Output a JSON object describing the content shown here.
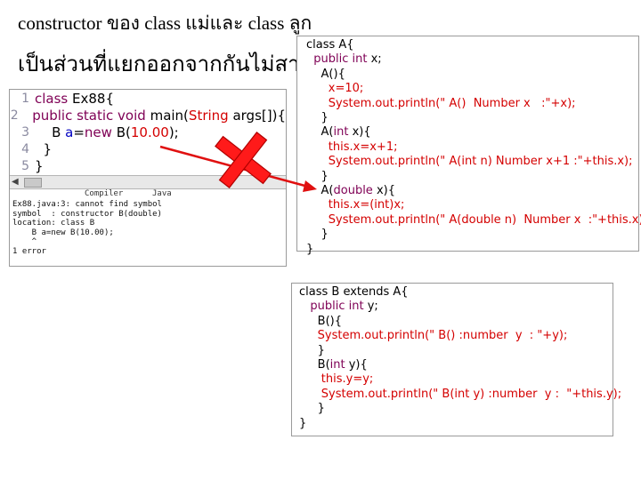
{
  "header": {
    "line1": "constructor ของ class แม่และ   class ลูก",
    "line2": "เป็นส่วนที่แยกออกจากกันไม่สามารถ"
  },
  "classA": {
    "lines": [
      [
        [
          "class A{",
          "blk"
        ]
      ],
      [
        [
          "  public int ",
          "k"
        ],
        [
          "x;",
          "blk"
        ]
      ],
      [
        [
          "    A(){",
          "blk"
        ]
      ],
      [
        [
          "      x=10;",
          "red"
        ]
      ],
      [
        [
          "      System.out.println(\" A()  Number x   :\"+x);",
          "red"
        ]
      ],
      [
        [
          "    }",
          "blk"
        ]
      ],
      [
        [
          "    A(",
          "blk"
        ],
        [
          "int",
          "k"
        ],
        [
          " x){",
          "blk"
        ]
      ],
      [
        [
          "      this.x=x+1;",
          "red"
        ]
      ],
      [
        [
          "      System.out.println(\" A(int n) Number x+1 :\"+this.x);",
          "red"
        ]
      ],
      [
        [
          "    }",
          "blk"
        ]
      ],
      [
        [
          "    A(",
          "blk"
        ],
        [
          "double",
          "k"
        ],
        [
          " x){",
          "blk"
        ]
      ],
      [
        [
          "      this.x=(int)x;",
          "red"
        ]
      ],
      [
        [
          "      System.out.println(\" A(double n)  Number x  :\"+this.x);",
          "red"
        ]
      ],
      [
        [
          "    }",
          "blk"
        ]
      ],
      [
        [
          "}",
          "blk"
        ]
      ]
    ]
  },
  "classB": {
    "lines": [
      [
        [
          "class B extends A{",
          "blk"
        ]
      ],
      [
        [
          "   public int ",
          "k"
        ],
        [
          "y;",
          "blk"
        ]
      ],
      [
        [
          "     B(){",
          "blk"
        ]
      ],
      [
        [
          "     System.out.println(\" B() :number  y  : \"+y);",
          "red"
        ]
      ],
      [
        [
          "     }",
          "blk"
        ]
      ],
      [
        [
          "     B(",
          "blk"
        ],
        [
          "int",
          "k"
        ],
        [
          " y){",
          "blk"
        ]
      ],
      [
        [
          "      this.y=y;",
          "red"
        ]
      ],
      [
        [
          "      System.out.println(\" B(int y) :number  y :  \"+this.y);",
          "red"
        ]
      ],
      [
        [
          "     }",
          "blk"
        ]
      ],
      [
        [
          "}",
          "blk"
        ]
      ]
    ]
  },
  "editor": {
    "lines": [
      {
        "num": "1",
        "segs": [
          [
            "class ",
            "kw"
          ],
          [
            "Ex88{",
            "blk"
          ]
        ]
      },
      {
        "num": "2",
        "segs": [
          [
            "  public static void ",
            "kw"
          ],
          [
            "main(",
            "blk"
          ],
          [
            "String",
            "red"
          ],
          [
            " args[]){",
            "blk"
          ]
        ]
      },
      {
        "num": "3",
        "segs": [
          [
            "    B ",
            "blk"
          ],
          [
            "a",
            "fld"
          ],
          [
            "=",
            "blk"
          ],
          [
            "new ",
            "kw"
          ],
          [
            "B(",
            "blk"
          ],
          [
            "10.00",
            "red"
          ],
          [
            ");",
            "blk"
          ]
        ]
      },
      {
        "num": "4",
        "segs": [
          [
            "  }",
            "blk"
          ]
        ]
      },
      {
        "num": "5",
        "segs": [
          [
            "}",
            "blk"
          ]
        ]
      }
    ],
    "tab_compiler": "Compiler",
    "tab_java": "Java",
    "console": [
      "Ex88.java:3: cannot find symbol",
      "symbol  : constructor B(double)",
      "location: class B",
      "    B a=new B(10.00);",
      "    ^",
      "1 error"
    ]
  },
  "colors": {
    "keyword": "#7f0055",
    "code_red": "#d40000",
    "arrow_red": "#e01010",
    "x_mark": "#ff1a1a"
  }
}
